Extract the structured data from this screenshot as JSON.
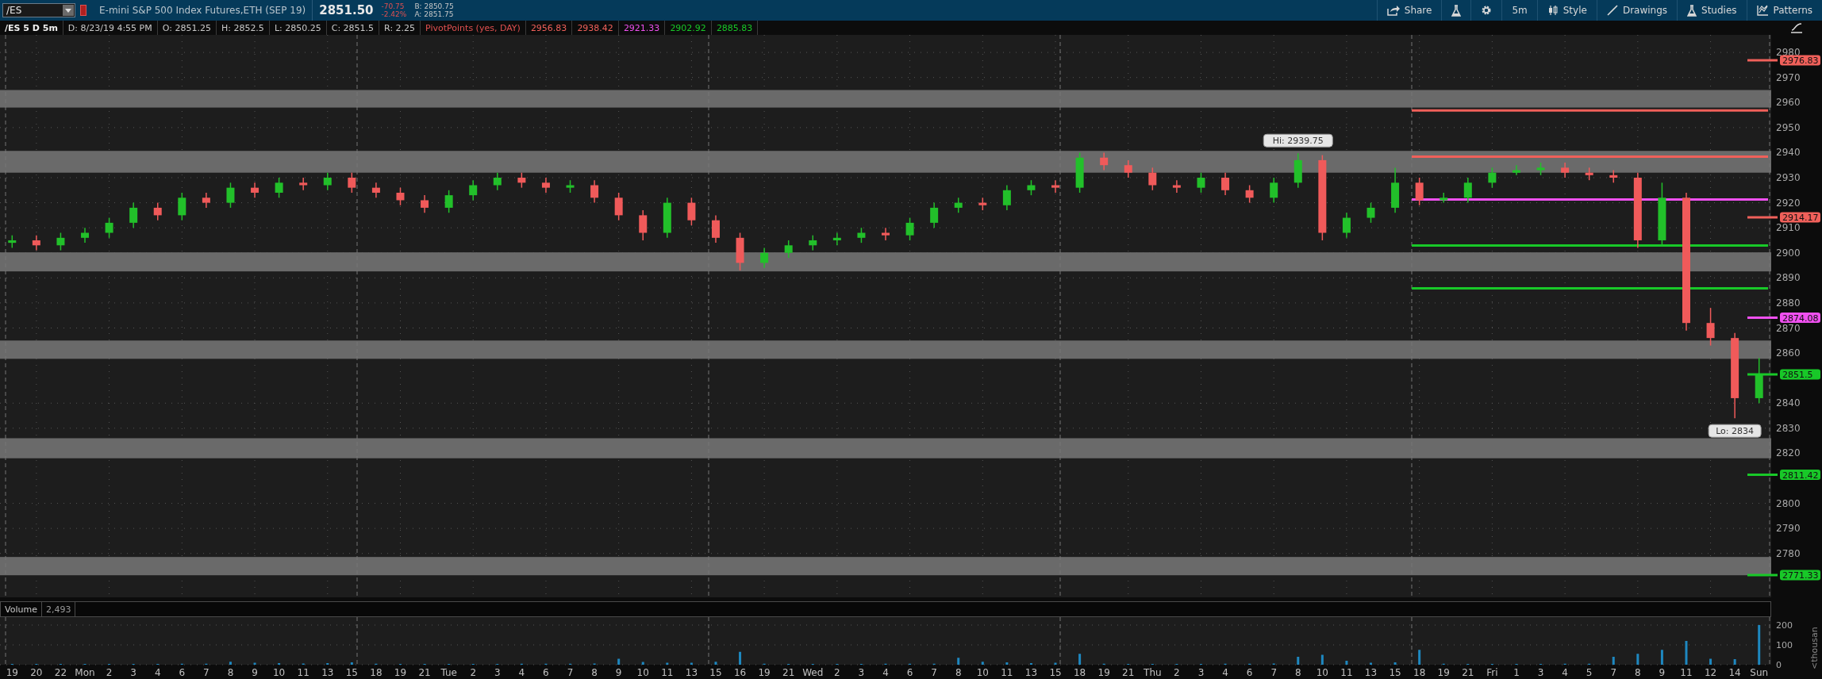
{
  "toolbar": {
    "symbol": "/ES",
    "description": "E-mini S&P 500 Index Futures,ETH (SEP 19)",
    "last": "2851.50",
    "change": "-70.75",
    "change_pct": "-2.42%",
    "bid": "B: 2850.75",
    "ask": "A: 2851.75",
    "buttons": [
      {
        "kind": "share",
        "label": "Share"
      },
      {
        "kind": "flask"
      },
      {
        "kind": "gear"
      },
      {
        "kind": "text",
        "label": "5m"
      },
      {
        "kind": "style",
        "label": "Style"
      },
      {
        "kind": "drawings",
        "label": "Drawings"
      },
      {
        "kind": "studies",
        "label": "Studies"
      },
      {
        "kind": "patterns",
        "label": "Patterns"
      }
    ]
  },
  "info_bar": {
    "title": "/ES 5 D 5m",
    "fields": [
      "D: 8/23/19 4:55 PM",
      "O: 2851.25",
      "H: 2852.5",
      "L: 2850.25",
      "C: 2851.5",
      "R: 2.25"
    ],
    "study": {
      "label": "PivotPoints (yes, DAY)",
      "values": [
        {
          "text": "2956.83",
          "color": "#f0605a"
        },
        {
          "text": "2938.42",
          "color": "#f0605a"
        },
        {
          "text": "2921.33",
          "color": "#f050f0"
        },
        {
          "text": "2902.92",
          "color": "#18c828"
        },
        {
          "text": "2885.83",
          "color": "#18c828"
        }
      ]
    }
  },
  "price_chart": {
    "chart_data": {
      "type": "candlestick",
      "grid": true,
      "ylim": [
        2762.5,
        2987
      ],
      "yticks": [
        2780,
        2790,
        2800,
        2820,
        2830,
        2840,
        2860,
        2870,
        2880,
        2890,
        2900,
        2910,
        2920,
        2930,
        2940,
        2950,
        2960,
        2970,
        2980
      ],
      "ohlc": [
        [
          2904,
          2907,
          2902,
          2905
        ],
        [
          2905,
          2907,
          2901,
          2903
        ],
        [
          2903,
          2908,
          2901,
          2906
        ],
        [
          2906,
          2910,
          2904,
          2908
        ],
        [
          2908,
          2914,
          2906,
          2912
        ],
        [
          2912,
          2920,
          2910,
          2918
        ],
        [
          2918,
          2920,
          2913,
          2915
        ],
        [
          2915,
          2924,
          2913,
          2922
        ],
        [
          2922,
          2924,
          2918,
          2920
        ],
        [
          2920,
          2928,
          2918,
          2926
        ],
        [
          2926,
          2928,
          2922,
          2924
        ],
        [
          2924,
          2930,
          2922,
          2928
        ],
        [
          2928,
          2930,
          2925,
          2927
        ],
        [
          2927,
          2932,
          2925,
          2930
        ],
        [
          2930,
          2932,
          2924,
          2926
        ],
        [
          2926,
          2928,
          2922,
          2924
        ],
        [
          2924,
          2926,
          2919,
          2921
        ],
        [
          2921,
          2923,
          2916,
          2918
        ],
        [
          2918,
          2925,
          2916,
          2923
        ],
        [
          2923,
          2929,
          2921,
          2927
        ],
        [
          2927,
          2932,
          2925,
          2930
        ],
        [
          2930,
          2932,
          2926,
          2928
        ],
        [
          2928,
          2930,
          2924,
          2926
        ],
        [
          2926,
          2929,
          2924,
          2927
        ],
        [
          2927,
          2929,
          2920,
          2922
        ],
        [
          2922,
          2924,
          2913,
          2915
        ],
        [
          2915,
          2917,
          2905,
          2908
        ],
        [
          2908,
          2922,
          2906,
          2920
        ],
        [
          2920,
          2922,
          2911,
          2913
        ],
        [
          2913,
          2915,
          2904,
          2906
        ],
        [
          2906,
          2908,
          2893,
          2896
        ],
        [
          2896,
          2902,
          2894,
          2900
        ],
        [
          2900,
          2905,
          2898,
          2903
        ],
        [
          2903,
          2907,
          2901,
          2905
        ],
        [
          2905,
          2908,
          2903,
          2906
        ],
        [
          2906,
          2910,
          2904,
          2908
        ],
        [
          2908,
          2910,
          2905,
          2907
        ],
        [
          2907,
          2914,
          2905,
          2912
        ],
        [
          2912,
          2920,
          2910,
          2918
        ],
        [
          2918,
          2922,
          2916,
          2920
        ],
        [
          2920,
          2922,
          2917,
          2919
        ],
        [
          2919,
          2927,
          2917,
          2925
        ],
        [
          2925,
          2929,
          2923,
          2927
        ],
        [
          2927,
          2929,
          2924,
          2926
        ],
        [
          2926,
          2940,
          2924,
          2938
        ],
        [
          2938,
          2940,
          2933,
          2935
        ],
        [
          2935,
          2937,
          2930,
          2932
        ],
        [
          2932,
          2934,
          2925,
          2927
        ],
        [
          2927,
          2929,
          2924,
          2926
        ],
        [
          2926,
          2932,
          2924,
          2930
        ],
        [
          2930,
          2932,
          2923,
          2925
        ],
        [
          2925,
          2927,
          2920,
          2922
        ],
        [
          2922,
          2930,
          2920,
          2928
        ],
        [
          2928,
          2939.75,
          2926,
          2937
        ],
        [
          2937,
          2939,
          2905,
          2908
        ],
        [
          2908,
          2916,
          2906,
          2914
        ],
        [
          2914,
          2920,
          2912,
          2918
        ],
        [
          2918,
          2934,
          2916,
          2928
        ],
        [
          2928,
          2930,
          2919,
          2921
        ],
        [
          2921,
          2924,
          2920,
          2922
        ],
        [
          2922,
          2930,
          2920,
          2928
        ],
        [
          2928,
          2934,
          2926,
          2932
        ],
        [
          2932,
          2935,
          2931,
          2933
        ],
        [
          2933,
          2936,
          2931,
          2934
        ],
        [
          2934,
          2936,
          2930,
          2932
        ],
        [
          2932,
          2934,
          2929,
          2931
        ],
        [
          2931,
          2933,
          2928,
          2930
        ],
        [
          2930,
          2932,
          2902,
          2905
        ],
        [
          2905,
          2928,
          2903,
          2922
        ],
        [
          2922,
          2924,
          2869,
          2872
        ],
        [
          2872,
          2878,
          2863,
          2866
        ],
        [
          2866,
          2868,
          2834,
          2842
        ],
        [
          2842,
          2858,
          2840,
          2851.5
        ]
      ],
      "bands": [
        {
          "axis": "y",
          "from": 2958,
          "to": 2965
        },
        {
          "axis": "y",
          "from": 2932,
          "to": 2940.7
        },
        {
          "axis": "y",
          "from": 2892.6,
          "to": 2900.2
        },
        {
          "axis": "y",
          "from": 2857.7,
          "to": 2865
        },
        {
          "axis": "y",
          "from": 2818,
          "to": 2826
        },
        {
          "axis": "y",
          "from": 2771.3,
          "to": 2778.6
        }
      ],
      "ref_lines": [
        {
          "axis": "y",
          "value": 2956.83,
          "color": "#f0605a"
        },
        {
          "axis": "y",
          "value": 2938.42,
          "color": "#f0605a"
        },
        {
          "axis": "y",
          "value": 2921.33,
          "color": "#f050f0"
        },
        {
          "axis": "y",
          "value": 2902.92,
          "color": "#18c828"
        },
        {
          "axis": "y",
          "value": 2885.83,
          "color": "#18c828"
        },
        {
          "axis": "y",
          "value": 2976.83,
          "label": "2976.83",
          "color": "#f0605a"
        },
        {
          "axis": "y",
          "value": 2914.17,
          "label": "2914.17",
          "color": "#f0605a"
        },
        {
          "axis": "y",
          "value": 2874.08,
          "label": "2874.08",
          "color": "#f050f0"
        },
        {
          "axis": "y",
          "value": 2851.5,
          "label": "2851.5",
          "color": "#18c828"
        },
        {
          "axis": "y",
          "value": 2811.42,
          "label": "2811.42",
          "color": "#18c828"
        },
        {
          "axis": "y",
          "value": 2771.33,
          "label": "2771.33",
          "color": "#18c828"
        }
      ],
      "annotations": [
        {
          "text": "Hi: 2939.75",
          "y": 2939.75
        },
        {
          "text": "Lo: 2834",
          "y": 2834
        }
      ]
    }
  },
  "volume_pane": {
    "value": "2,493",
    "unit_label": "<thousan",
    "chart_data": {
      "type": "bar",
      "grid": true,
      "ylim": [
        0,
        240
      ],
      "yticks": [
        0,
        100,
        200
      ],
      "categories": [
        "19",
        "20",
        "22",
        "Mon",
        "2",
        "3",
        "4",
        "6",
        "7",
        "8",
        "9",
        "10",
        "11",
        "13",
        "15",
        "18",
        "19",
        "21",
        "Tue",
        "2",
        "3",
        "4",
        "6",
        "7",
        "8",
        "9",
        "10",
        "11",
        "13",
        "15",
        "16",
        "19",
        "21",
        "Wed",
        "2",
        "3",
        "4",
        "6",
        "7",
        "8",
        "10",
        "11",
        "13",
        "15",
        "18",
        "19",
        "21",
        "Thu",
        "2",
        "3",
        "4",
        "6",
        "7",
        "8",
        "10",
        "11",
        "13",
        "15",
        "18",
        "19",
        "21",
        "Fri",
        "1",
        "3",
        "4",
        "5",
        "7",
        "8",
        "9",
        "11",
        "12",
        "14",
        "Sun"
      ],
      "series": [
        {
          "name": "Volume",
          "color": "#1e88c0",
          "values": [
            4,
            4,
            4,
            4,
            4,
            4,
            4,
            5,
            5,
            15,
            10,
            8,
            6,
            8,
            12,
            5,
            4,
            4,
            4,
            4,
            4,
            5,
            5,
            5,
            6,
            30,
            14,
            10,
            10,
            15,
            65,
            5,
            4,
            4,
            4,
            4,
            5,
            5,
            5,
            35,
            15,
            12,
            8,
            10,
            55,
            5,
            4,
            4,
            4,
            4,
            5,
            5,
            6,
            40,
            50,
            20,
            10,
            12,
            75,
            5,
            4,
            4,
            4,
            4,
            5,
            5,
            40,
            55,
            75,
            120,
            30,
            28,
            200
          ]
        }
      ]
    }
  }
}
